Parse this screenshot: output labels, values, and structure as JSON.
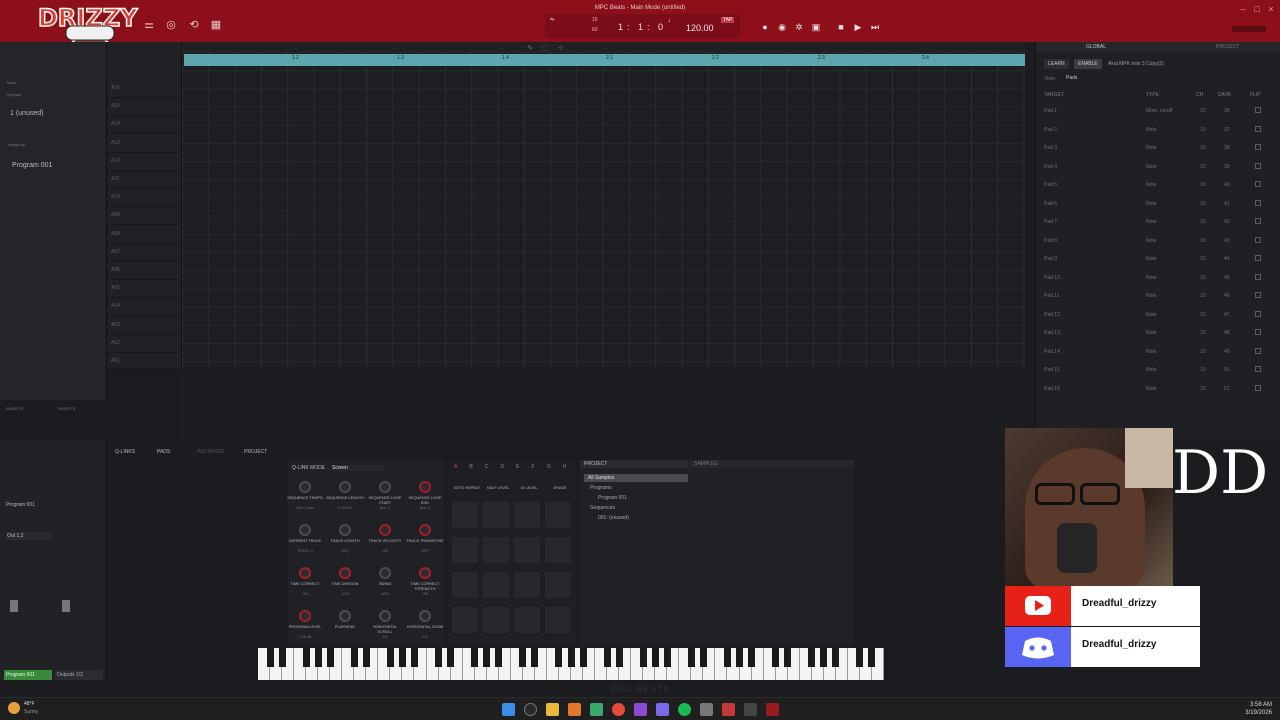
{
  "window": {
    "title": "MPC Beats - Main Mode (untitled)",
    "bpm": "120.00",
    "bars": "1",
    "beats": "1",
    "ticks": "0",
    "tap_label": "TAP",
    "bar_field": "16",
    "loop_field": "60"
  },
  "left_panel": {
    "labels": [
      "Track",
      "Program",
      "Keygroup",
      "1 (unused)",
      "Program 001"
    ],
    "mixer_program": "Program 001",
    "mixer_output": "Out 1,2",
    "inserts_label": "INSERTS",
    "bottom_tabs": [
      "Program 001",
      "Outputs 1/2"
    ]
  },
  "tracks": {
    "row_labels": [
      "A16",
      "A15",
      "A14",
      "A13",
      "A12",
      "A11",
      "A10",
      "A09",
      "A08",
      "A07",
      "A06",
      "A05",
      "A04",
      "A03",
      "A02",
      "A01"
    ]
  },
  "ruler": {
    "marks": [
      "1.2",
      "1.3",
      "1.4",
      "2.1",
      "2.2",
      "2.3",
      "2.4"
    ]
  },
  "inspector": {
    "tabs": [
      "GLOBAL",
      "PROJECT"
    ],
    "controller_tabs": [
      "LEARN",
      "ENABLE"
    ],
    "controller_name": "Akai MPK mini 3 Copy(2)",
    "view_label": "View",
    "view_value": "Pads",
    "headers": [
      "TARGET",
      "TYPE",
      "CH",
      "DATA",
      "FLIP"
    ],
    "rows": [
      {
        "target": "Pad 1",
        "type": "Mom. on/off",
        "ch": "10",
        "data": "36"
      },
      {
        "target": "Pad 2",
        "type": "Note",
        "ch": "10",
        "data": "37"
      },
      {
        "target": "Pad 3",
        "type": "Note",
        "ch": "10",
        "data": "38"
      },
      {
        "target": "Pad 4",
        "type": "Note",
        "ch": "10",
        "data": "39"
      },
      {
        "target": "Pad 5",
        "type": "Note",
        "ch": "10",
        "data": "40"
      },
      {
        "target": "Pad 6",
        "type": "Note",
        "ch": "10",
        "data": "41"
      },
      {
        "target": "Pad 7",
        "type": "Note",
        "ch": "10",
        "data": "42"
      },
      {
        "target": "Pad 8",
        "type": "Note",
        "ch": "10",
        "data": "43"
      },
      {
        "target": "Pad 9",
        "type": "Note",
        "ch": "10",
        "data": "44"
      },
      {
        "target": "Pad 10",
        "type": "Note",
        "ch": "10",
        "data": "45"
      },
      {
        "target": "Pad 11",
        "type": "Note",
        "ch": "10",
        "data": "46"
      },
      {
        "target": "Pad 12",
        "type": "Note",
        "ch": "10",
        "data": "47"
      },
      {
        "target": "Pad 13",
        "type": "Note",
        "ch": "10",
        "data": "48"
      },
      {
        "target": "Pad 14",
        "type": "Note",
        "ch": "10",
        "data": "49"
      },
      {
        "target": "Pad 15",
        "type": "Note",
        "ch": "10",
        "data": "50"
      },
      {
        "target": "Pad 16",
        "type": "Note",
        "ch": "10",
        "data": "51"
      }
    ]
  },
  "bottom_tabs": [
    "Q-LINKS",
    "PADS",
    "PAD MIXER",
    "PROJECT"
  ],
  "qlink": {
    "mode_label": "Q-LINK MODE",
    "mode_value": "Screen",
    "knobs": [
      {
        "label": "SEQUENCE TEMPO",
        "value": "120.0 bpm",
        "red": false
      },
      {
        "label": "SEQUENCE LENGTH",
        "value": "2 BARS",
        "red": false
      },
      {
        "label": "SEQUENCE LOOP START",
        "value": "Bar: 1",
        "red": false
      },
      {
        "label": "SEQUENCE LOOP END",
        "value": "Bar: 2",
        "red": true
      },
      {
        "label": "CURRENT TRACK",
        "value": "TRACK 1",
        "red": false
      },
      {
        "label": "TRACK LENGTH",
        "value": "SEQ",
        "red": false
      },
      {
        "label": "TRACK VELOCITY",
        "value": "100",
        "red": true
      },
      {
        "label": "TRACK TRANSPOSE",
        "value": "OFF",
        "red": true
      },
      {
        "label": "TIME CORRECT",
        "value": "ON",
        "red": true
      },
      {
        "label": "TIME DIVISION",
        "value": "1/16",
        "red": true
      },
      {
        "label": "SWING",
        "value": "50%",
        "red": false
      },
      {
        "label": "TIME CORRECT STRENGTH",
        "value": "100",
        "red": true
      },
      {
        "label": "PROGRAM LEVEL",
        "value": "0.00 dB",
        "red": true
      },
      {
        "label": "PLAYHEAD",
        "value": "",
        "red": false
      },
      {
        "label": "HORIZONTAL SCROLL",
        "value": "0%",
        "red": false
      },
      {
        "label": "HORIZONTAL ZOOM",
        "value": "0%",
        "red": false
      }
    ]
  },
  "pads": {
    "banks": [
      "A",
      "B",
      "C",
      "D",
      "E",
      "F",
      "G",
      "H"
    ],
    "functions": [
      "NOTE REPEAT",
      "HALF LEVEL",
      "16 LEVEL",
      "ERASE"
    ]
  },
  "browser": {
    "project_label": "PROJECT",
    "samples_label": "SAMPLES",
    "items": [
      "All Samples",
      "Programs",
      "Program 001",
      "Sequences",
      "001: (unused)"
    ]
  },
  "overlay": {
    "channel_name_youtube": "Dreadful_drizzy",
    "channel_name_discord": "Dreadful_drizzy",
    "logo_text": "DD",
    "sticker_text": "DRIZZY",
    "watermark": "MPC BEATS"
  },
  "taskbar": {
    "weather_temp": "48°F",
    "weather_desc": "Sunny",
    "time": "3:58 AM",
    "date": "3/19/2026"
  },
  "colors": {
    "topbar": "#8c0f1a",
    "ruler": "#5ea6ad",
    "accent_red": "#a51d2a",
    "mixer_green": "#3a8a3a",
    "youtube": "#e62117",
    "discord": "#5865f2"
  }
}
